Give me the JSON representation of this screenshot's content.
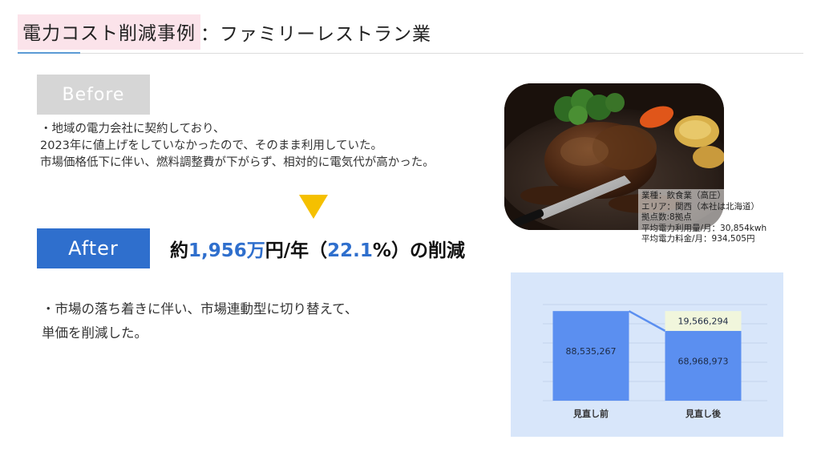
{
  "title": {
    "highlight": "電力コスト削減事例",
    "rest": "：ファミリーレストラン業"
  },
  "before": {
    "label": "Before",
    "lines": [
      "・地域の電力会社に契約しており、",
      "2023年に値上げをしていなかったので、そのまま利用していた。",
      "市場価格低下に伴い、燃料調整費が下がらず、相対的に電気代が高かった。"
    ]
  },
  "after": {
    "label": "After",
    "result": {
      "prefix": "約",
      "amount": "1,956万",
      "middle": "円/年（",
      "percent": "22.1",
      "suffix": "%）の削減"
    },
    "lines": [
      "・市場の落ち着きに伴い、市場連動型に切り替えて、",
      "単価を削減した。"
    ]
  },
  "company_info": {
    "lines": [
      "業種：飲食業（高圧）",
      "エリア：関西（本社は北海道）",
      "拠点数:8拠点",
      "平均電力利用量/月：30,854kwh",
      "平均電力料金/月：934,505円"
    ]
  },
  "colors": {
    "title_highlight": "#fbe3ea",
    "before_box": "#d6d6d6",
    "after_box": "#2f6fcd",
    "arrow": "#f5c000",
    "chart_bg": "#d8e6fa",
    "bar": "#5b8ff0",
    "saving_segment": "#f1f6dc"
  },
  "chart_data": {
    "type": "bar",
    "categories": [
      "見直し前",
      "見直し後"
    ],
    "series": [
      {
        "values": [
          88535267,
          68968973
        ]
      },
      {
        "values": [
          0,
          19566294
        ]
      }
    ],
    "data_labels": [
      "88,535,267",
      "68,968,973",
      "19,566,294"
    ],
    "stacked": true,
    "ylim": [
      0,
      95000000
    ],
    "grid": true
  }
}
